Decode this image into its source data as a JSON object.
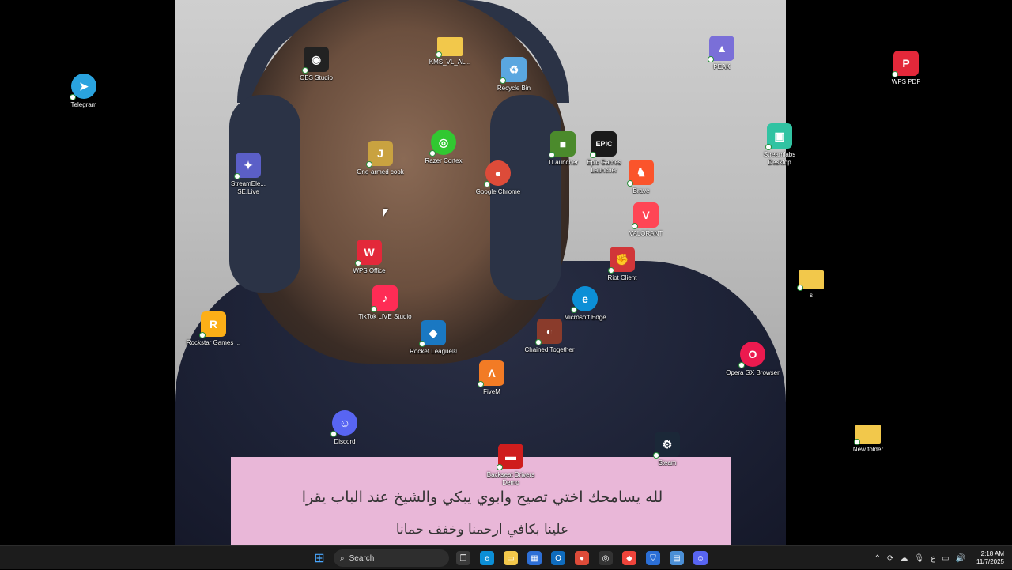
{
  "wallpaper": {
    "caption_line1": "لله يسامحك اختي تصيح وابوي يبكي والشيخ عند الباب يقرا",
    "caption_line2": "علينا بكافي ارحمنا وخفف حمانا"
  },
  "desktop_icons": [
    {
      "label": "Telegram",
      "icon": "telegram-icon",
      "color": "#2aa3df",
      "glyph": "➤"
    },
    {
      "label": "OBS Studio",
      "icon": "obs-icon",
      "color": "#222222",
      "glyph": "◉"
    },
    {
      "label": "KMS_VL_AL...",
      "icon": "folder-icon",
      "color": "#f2c84b",
      "glyph": ""
    },
    {
      "label": "Recycle Bin",
      "icon": "recycle-bin-icon",
      "color": "#5aa7e0",
      "glyph": "♻"
    },
    {
      "label": "PEAK",
      "icon": "peak-icon",
      "color": "#7a6fd8",
      "glyph": "▲"
    },
    {
      "label": "WPS PDF",
      "icon": "wps-pdf-icon",
      "color": "#e3283a",
      "glyph": "P"
    },
    {
      "label": "One-armed cook",
      "icon": "one-armed-cook-icon",
      "color": "#c9a240",
      "glyph": "J"
    },
    {
      "label": "Razer Cortex",
      "icon": "razer-cortex-icon",
      "color": "#31c831",
      "glyph": "◎"
    },
    {
      "label": "TLauncher",
      "icon": "tlauncher-icon",
      "color": "#4b8a2c",
      "glyph": "■"
    },
    {
      "label": "Epic Games Launcher",
      "icon": "epic-games-icon",
      "color": "#1a1a1a",
      "glyph": "EPIC"
    },
    {
      "label": "Streamlabs Desktop",
      "icon": "streamlabs-icon",
      "color": "#31c3a2",
      "glyph": "▣"
    },
    {
      "label": "StreamEle... SE.Live",
      "icon": "streamelements-icon",
      "color": "#5b5fc7",
      "glyph": "✦"
    },
    {
      "label": "Google Chrome",
      "icon": "chrome-icon",
      "color": "#dd4b39",
      "glyph": "●"
    },
    {
      "label": "Brave",
      "icon": "brave-icon",
      "color": "#fb542b",
      "glyph": "♞"
    },
    {
      "label": "VALORANT",
      "icon": "valorant-icon",
      "color": "#ff4655",
      "glyph": "V"
    },
    {
      "label": "WPS Office",
      "icon": "wps-office-icon",
      "color": "#e3283a",
      "glyph": "W"
    },
    {
      "label": "Riot Client",
      "icon": "riot-client-icon",
      "color": "#d13639",
      "glyph": "✊"
    },
    {
      "label": "s",
      "icon": "folder-icon",
      "color": "#f2c84b",
      "glyph": ""
    },
    {
      "label": "TikTok LIVE Studio",
      "icon": "tiktok-live-icon",
      "color": "#fe2c55",
      "glyph": "♪"
    },
    {
      "label": "Microsoft Edge",
      "icon": "edge-icon",
      "color": "#0c8fd6",
      "glyph": "e"
    },
    {
      "label": "Rockstar Games ...",
      "icon": "rockstar-icon",
      "color": "#fcaf17",
      "glyph": "R"
    },
    {
      "label": "Rocket League®",
      "icon": "rocket-league-icon",
      "color": "#1a78c2",
      "glyph": "◆"
    },
    {
      "label": "Chained Together",
      "icon": "chained-together-icon",
      "color": "#8a3b2b",
      "glyph": "◐"
    },
    {
      "label": "Opera GX Browser",
      "icon": "opera-gx-icon",
      "color": "#ec1a4f",
      "glyph": "O"
    },
    {
      "label": "FiveM",
      "icon": "fivem-icon",
      "color": "#f27b25",
      "glyph": "Λ"
    },
    {
      "label": "Discord",
      "icon": "discord-icon",
      "color": "#5865f2",
      "glyph": "☺"
    },
    {
      "label": "Backseat Drivers Demo",
      "icon": "backseat-drivers-icon",
      "color": "#cf1d1d",
      "glyph": "▬"
    },
    {
      "label": "Steam",
      "icon": "steam-icon",
      "color": "#1b2838",
      "glyph": "⚙"
    },
    {
      "label": "New folder",
      "icon": "folder-icon",
      "color": "#f2c84b",
      "glyph": ""
    }
  ],
  "taskbar": {
    "search_placeholder": "Search",
    "apps": [
      {
        "name": "task-view",
        "icon": "task-view-icon",
        "color": "#3a3a3a",
        "glyph": "❐"
      },
      {
        "name": "edge",
        "icon": "edge-icon",
        "color": "#0c8fd6",
        "glyph": "e"
      },
      {
        "name": "file-explorer",
        "icon": "file-explorer-icon",
        "color": "#f2c84b",
        "glyph": "▭"
      },
      {
        "name": "microsoft-store",
        "icon": "store-icon",
        "color": "#2d6fd6",
        "glyph": "▦"
      },
      {
        "name": "outlook",
        "icon": "outlook-icon",
        "color": "#0f6cbd",
        "glyph": "O"
      },
      {
        "name": "chrome",
        "icon": "chrome-icon",
        "color": "#dd4b39",
        "glyph": "●"
      },
      {
        "name": "razer-cortex",
        "icon": "razer-cortex-icon",
        "color": "#333333",
        "glyph": "◎"
      },
      {
        "name": "anydesk",
        "icon": "anydesk-icon",
        "color": "#ef443b",
        "glyph": "◆"
      },
      {
        "name": "defender",
        "icon": "shield-icon",
        "color": "#2b6fd6",
        "glyph": "⛉"
      },
      {
        "name": "notepad",
        "icon": "notepad-icon",
        "color": "#4b8fd6",
        "glyph": "▤"
      },
      {
        "name": "discord",
        "icon": "discord-icon",
        "color": "#5865f2",
        "glyph": "☺"
      }
    ],
    "tray": {
      "language": "ع",
      "time": "2:18 AM",
      "date": "11/7/2025"
    }
  }
}
